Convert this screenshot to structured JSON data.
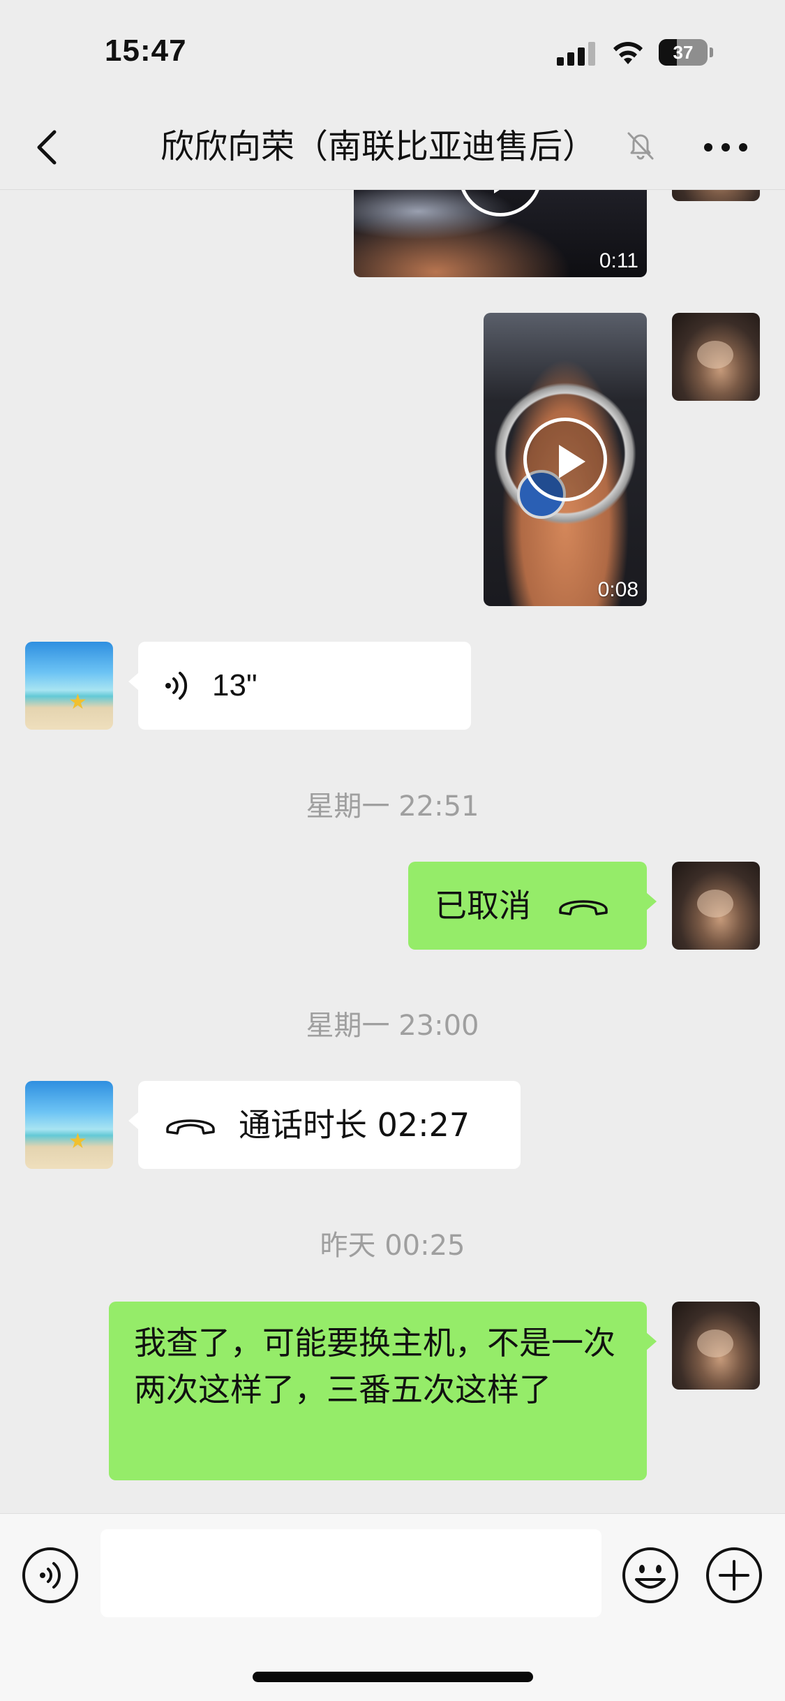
{
  "status_bar": {
    "time": "15:47",
    "battery_level": "37",
    "icons": [
      "signal-icon",
      "wifi-icon",
      "battery-icon"
    ]
  },
  "nav": {
    "title": "欣欣向荣（南联比亚迪售后）",
    "icons": [
      "back-icon",
      "mute-icon",
      "more-icon"
    ]
  },
  "messages": [
    {
      "type": "video",
      "from": "self",
      "duration": "0:11"
    },
    {
      "type": "video",
      "from": "self",
      "duration": "0:08"
    },
    {
      "type": "voice",
      "from": "other",
      "duration": "13\""
    },
    {
      "type": "timestamp",
      "text": "星期一 22:51"
    },
    {
      "type": "call",
      "from": "self",
      "text": "已取消"
    },
    {
      "type": "timestamp",
      "text": "星期一 23:00"
    },
    {
      "type": "call",
      "from": "other",
      "text": "通话时长 02:27"
    },
    {
      "type": "timestamp",
      "text": "昨天 00:25"
    },
    {
      "type": "text",
      "from": "self",
      "text": "我查了，可能要换主机，不是一次两次这样了，三番五次这样了"
    }
  ],
  "input_bar": {
    "placeholder": "",
    "icons": [
      "voice-input-icon",
      "emoji-icon",
      "plus-icon"
    ]
  },
  "colors": {
    "background": "#ededed",
    "self_bubble": "#95ec69",
    "other_bubble": "#ffffff",
    "timestamp_text": "#9f9f9f"
  }
}
